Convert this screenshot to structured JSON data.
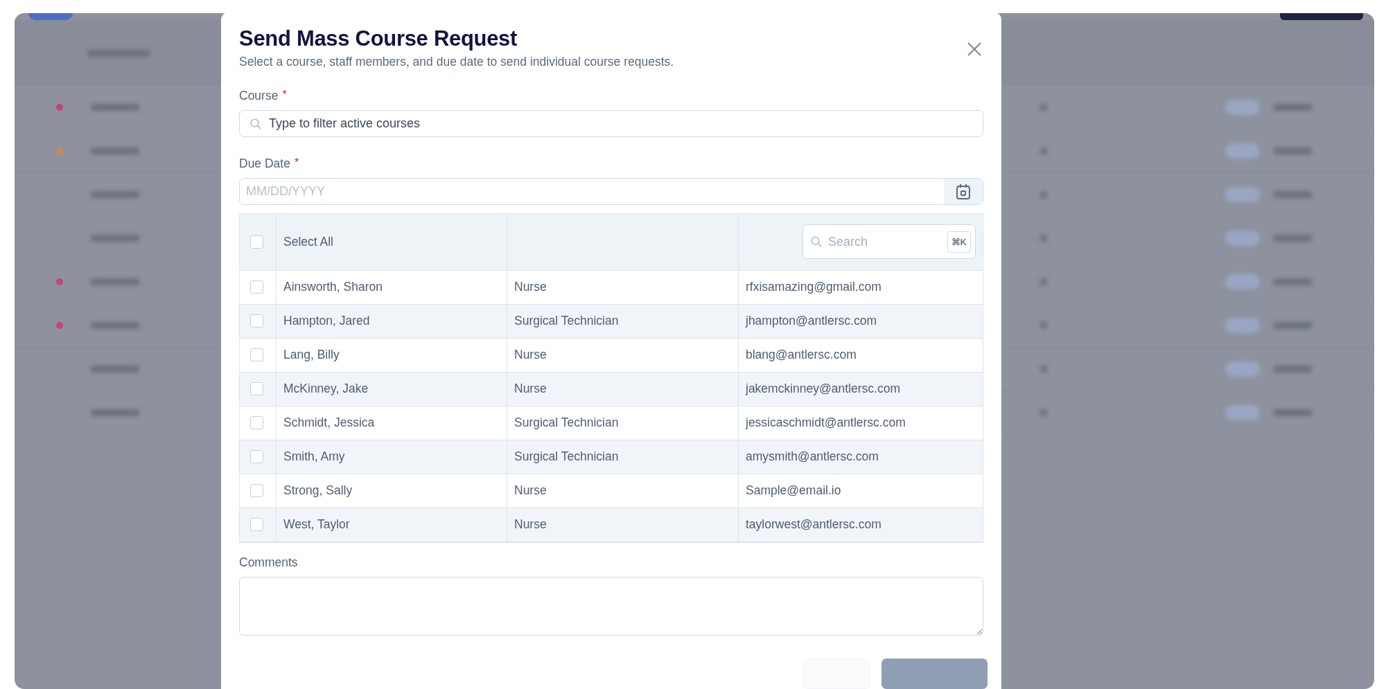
{
  "background": {
    "rows": [
      {
        "color": "#c0447e"
      },
      {
        "color": "#cf8a4a"
      },
      {},
      {},
      {
        "color": "#c0447e"
      },
      {
        "color": "#c0447e"
      },
      {},
      {}
    ]
  },
  "dialog": {
    "title": "Send Mass Course Request",
    "subtitle": "Select a course, staff members, and due date to send individual course requests.",
    "course": {
      "label": "Course",
      "required_mark": "*",
      "placeholder": "Type to filter active courses"
    },
    "due_date": {
      "label": "Due Date",
      "required_mark": "*",
      "placeholder": "MM/DD/YYYY"
    },
    "staff_table": {
      "select_all": {
        "label": "Select All",
        "checked": false
      },
      "search": {
        "placeholder": "Search",
        "shortcut": "⌘K"
      },
      "rows": [
        {
          "name": "Ainsworth, Sharon",
          "role": "Nurse",
          "email": "rfxisamazing@gmail.com",
          "checked": false
        },
        {
          "name": "Hampton, Jared",
          "role": "Surgical Technician",
          "email": "jhampton@antlersc.com",
          "checked": false
        },
        {
          "name": "Lang, Billy",
          "role": "Nurse",
          "email": "blang@antlersc.com",
          "checked": false
        },
        {
          "name": "McKinney, Jake",
          "role": "Nurse",
          "email": "jakemckinney@antlersc.com",
          "checked": false
        },
        {
          "name": "Schmidt, Jessica",
          "role": "Surgical Technician",
          "email": "jessicaschmidt@antlersc.com",
          "checked": false
        },
        {
          "name": "Smith, Amy",
          "role": "Surgical Technician",
          "email": "amysmith@antlersc.com",
          "checked": false
        },
        {
          "name": "Strong, Sally",
          "role": "Nurse",
          "email": "Sample@email.io",
          "checked": false
        },
        {
          "name": "West, Taylor",
          "role": "Nurse",
          "email": "taylorwest@antlersc.com",
          "checked": false
        }
      ]
    },
    "comments": {
      "label": "Comments"
    }
  }
}
